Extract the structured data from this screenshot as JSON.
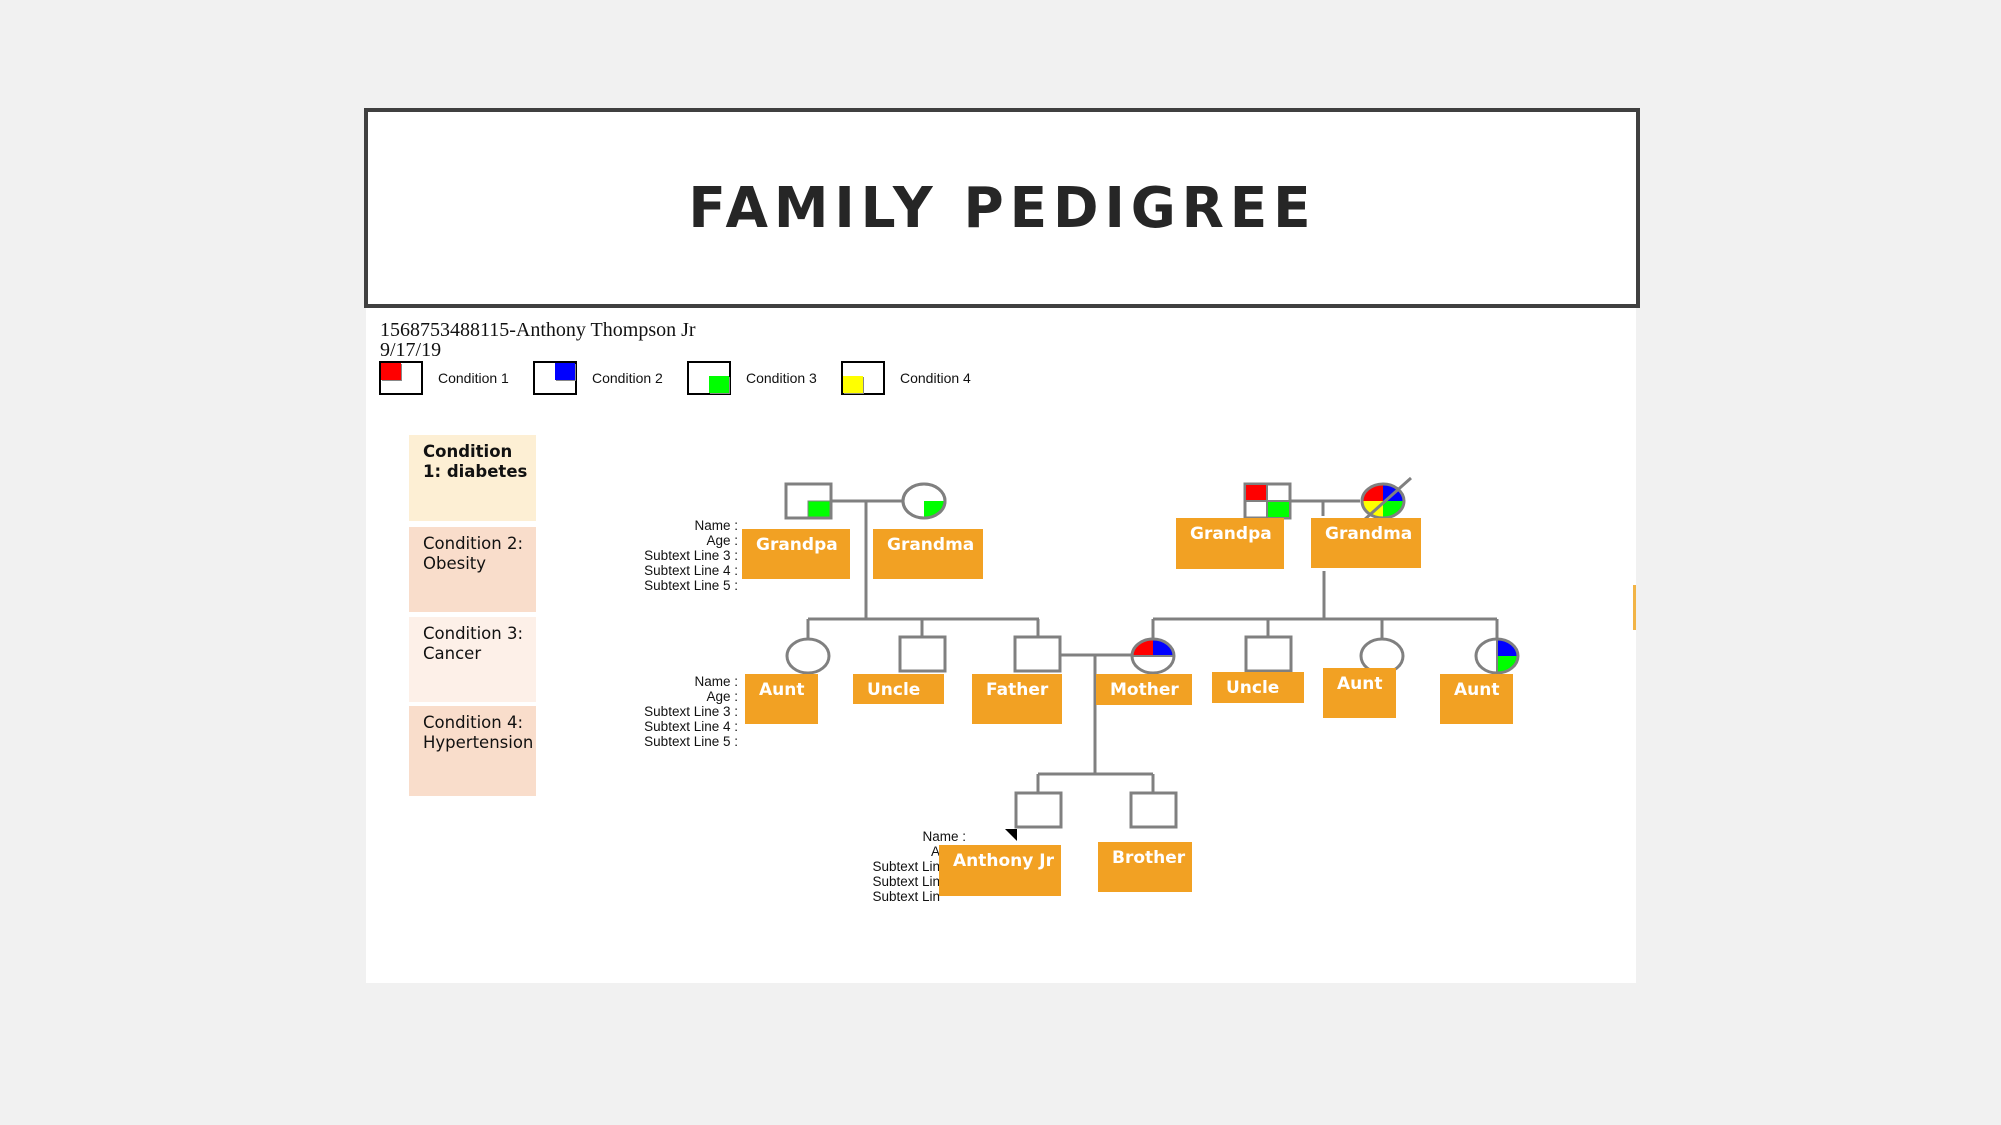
{
  "title": "FAMILY PEDIGREE",
  "header": {
    "patient_line": "1568753488115-Anthony Thompson Jr",
    "date": "9/17/19"
  },
  "legend": [
    {
      "label": "Condition 1",
      "color": "#ff0000",
      "corner": "top-left"
    },
    {
      "label": "Condition 2",
      "color": "#0000ff",
      "corner": "top-right"
    },
    {
      "label": "Condition 3",
      "color": "#00ff00",
      "corner": "bottom-right"
    },
    {
      "label": "Condition 4",
      "color": "#ffff00",
      "corner": "bottom-left"
    }
  ],
  "conditions": [
    {
      "text": "Condition 1: diabetes",
      "bg": "#fdefd4",
      "bold": true
    },
    {
      "text": "Condition 2: Obesity",
      "bg": "#f9ddcb",
      "bold": false
    },
    {
      "text": "Condition 3: Cancer",
      "bg": "#fdf0e8",
      "bold": false
    },
    {
      "text": "Condition 4: Hypertension",
      "bg": "#f9ddcb",
      "bold": false
    }
  ],
  "info_labels": {
    "full": [
      "Name :",
      "Age :",
      "Subtext Line 3 :",
      "Subtext Line 4 :",
      "Subtext Line 5 :"
    ],
    "truncated": [
      "Name :",
      "A",
      "Subtext Lin",
      "Subtext Lin",
      "Subtext Lin"
    ]
  },
  "people": {
    "pgf": {
      "name": "Grandpa",
      "sex": "male",
      "conditions": [
        3
      ]
    },
    "pgm": {
      "name": "Grandma",
      "sex": "female",
      "conditions": [
        3
      ]
    },
    "mgf": {
      "name": "Grandpa",
      "sex": "male",
      "conditions": [
        1,
        3
      ]
    },
    "mgm": {
      "name": "Grandma",
      "sex": "female",
      "conditions": [
        1,
        2,
        3,
        4
      ],
      "deceased": true
    },
    "aunt1": {
      "name": "Aunt",
      "sex": "female",
      "conditions": []
    },
    "uncle1": {
      "name": "Uncle",
      "sex": "male",
      "conditions": []
    },
    "father": {
      "name": "Father",
      "sex": "male",
      "conditions": []
    },
    "mother": {
      "name": "Mother",
      "sex": "female",
      "conditions": [
        1,
        2
      ]
    },
    "uncle2": {
      "name": "Uncle",
      "sex": "male",
      "conditions": []
    },
    "aunt2": {
      "name": "Aunt",
      "sex": "female",
      "conditions": []
    },
    "aunt3": {
      "name": "Aunt",
      "sex": "female",
      "conditions": [
        2,
        3
      ]
    },
    "proband": {
      "name": "Anthony Jr",
      "sex": "male",
      "conditions": [],
      "proband": true
    },
    "brother": {
      "name": "Brother",
      "sex": "male",
      "conditions": []
    }
  },
  "colors": {
    "condition1": "#ff0000",
    "condition2": "#0000ff",
    "condition3": "#00ff00",
    "condition4": "#ffff00",
    "name_box": "#f2a123",
    "line": "#808080"
  }
}
